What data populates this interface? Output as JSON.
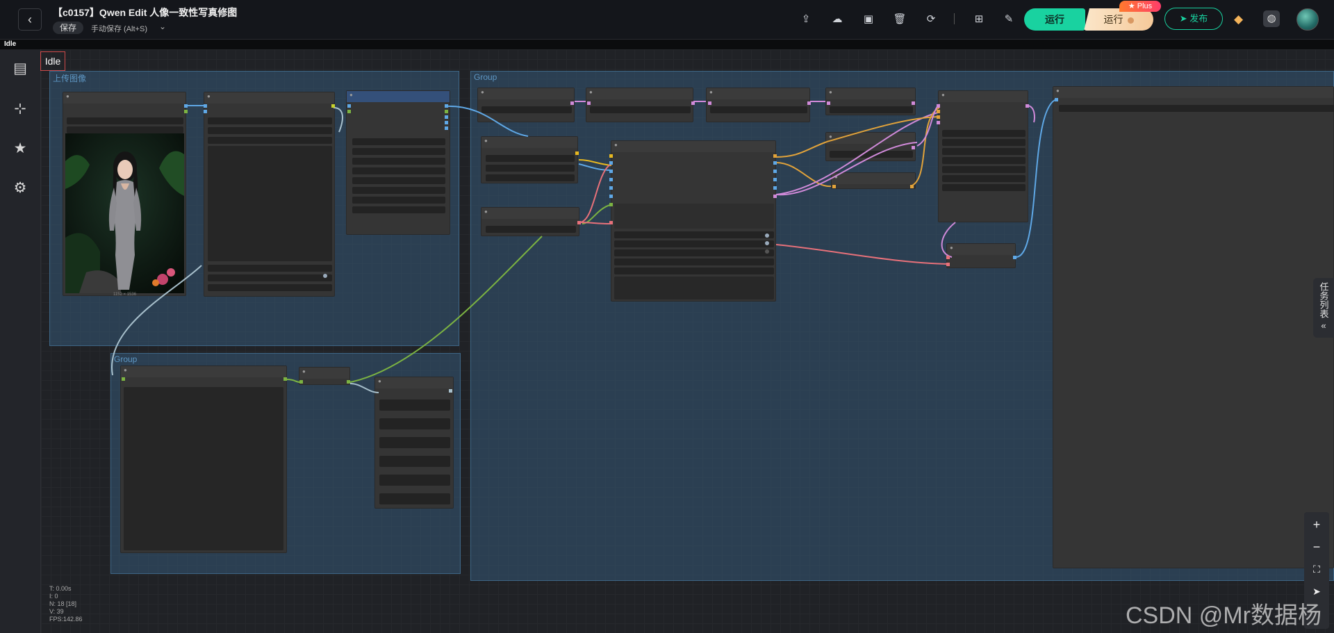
{
  "header": {
    "title": "【c0157】Qwen Edit 人像一致性写真修图",
    "save_label": "保存",
    "autosave_label": "手动保存 (Alt+S)",
    "run_label": "运行",
    "run_plus_label": "运行",
    "plus_badge": "Plus",
    "publish_label": "发布"
  },
  "status": {
    "strip_text": "Idle",
    "canvas_label": "Idle"
  },
  "canvas": {
    "groups": [
      {
        "title": "上传图像"
      },
      {
        "title": "Group"
      },
      {
        "title": "Group"
      }
    ],
    "image_caption": "1152 × 1536"
  },
  "sidebar": {
    "items": [
      "document-icon",
      "workflow-icon",
      "star-icon",
      "gear-icon"
    ]
  },
  "task_panel": {
    "label": "任务列表",
    "collapse_glyph": "«"
  },
  "stats": {
    "t": "T: 0.00s",
    "i": "I: 0",
    "n": "N: 18 [18]",
    "v": "V: 39",
    "fps": "FPS:142.86"
  },
  "watermark": "CSDN @Mr数据杨",
  "colors": {
    "accent": "#19d2a0",
    "group_fill": "#345876",
    "idle_border": "#d04b4b"
  }
}
